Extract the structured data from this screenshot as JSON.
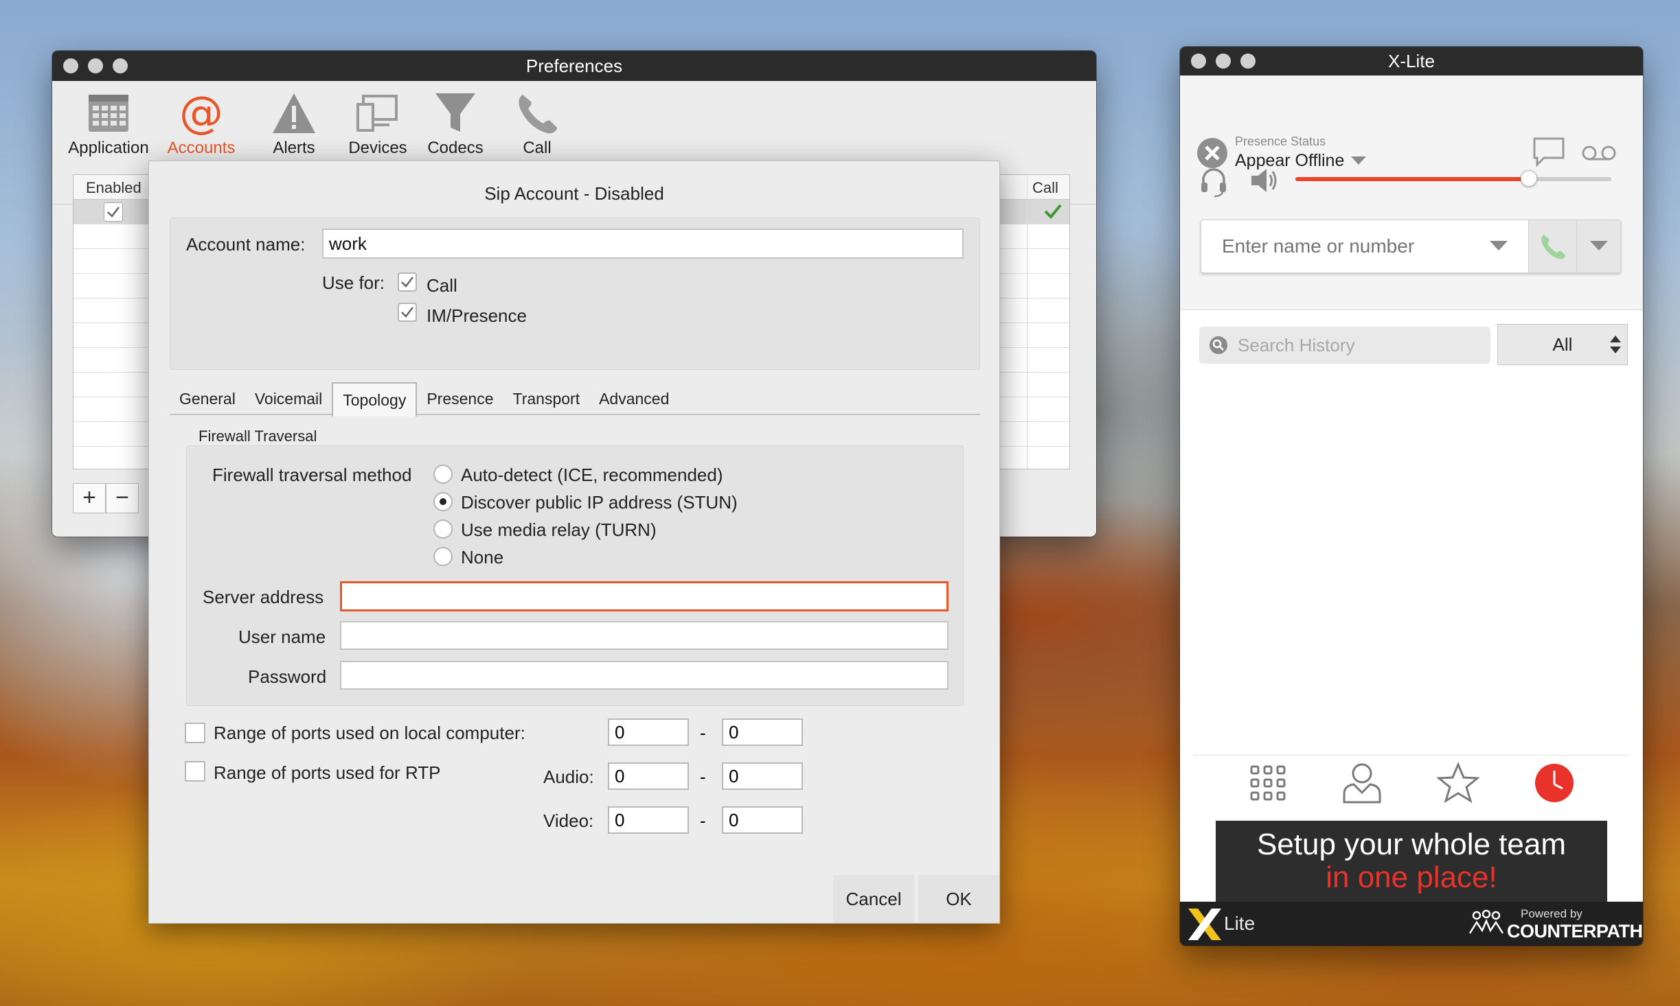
{
  "preferences": {
    "title": "Preferences",
    "toolbar": {
      "items": [
        {
          "label": "Application",
          "icon": "calendar-grid-icon"
        },
        {
          "label": "Accounts",
          "icon": "at-sign-icon"
        },
        {
          "label": "Alerts",
          "icon": "warning-triangle-icon"
        },
        {
          "label": "Devices",
          "icon": "devices-icon"
        },
        {
          "label": "Codecs",
          "icon": "funnel-icon"
        },
        {
          "label": "Call",
          "icon": "phone-icon"
        }
      ],
      "active": "Accounts"
    },
    "table": {
      "col_enabled": "Enabled",
      "col_call": "Call"
    },
    "add_label": "+",
    "remove_label": "−"
  },
  "sheet": {
    "title": "Sip Account - Disabled",
    "account_name_label": "Account name:",
    "account_name_value": "work",
    "use_for_label": "Use for:",
    "use_for": [
      {
        "label": "Call",
        "checked": true
      },
      {
        "label": "IM/Presence",
        "checked": true
      }
    ],
    "tabs": [
      "General",
      "Voicemail",
      "Topology",
      "Presence",
      "Transport",
      "Advanced"
    ],
    "active_tab": "Topology",
    "section_title": "Firewall Traversal",
    "method_label": "Firewall traversal method",
    "methods": [
      {
        "label": "Auto-detect (ICE, recommended)",
        "selected": false
      },
      {
        "label": "Discover public IP address (STUN)",
        "selected": true
      },
      {
        "label": "Use media relay (TURN)",
        "selected": false
      },
      {
        "label": "None",
        "selected": false
      }
    ],
    "server_address_label": "Server address",
    "server_address_value": "",
    "user_name_label": "User name",
    "user_name_value": "",
    "password_label": "Password",
    "password_value": "",
    "local_ports_label": "Range of ports used on local computer:",
    "rtp_ports_label": "Range of ports used for RTP",
    "audio_label": "Audio:",
    "video_label": "Video:",
    "dash": "-",
    "ports": {
      "local": [
        "0",
        "0"
      ],
      "audio": [
        "0",
        "0"
      ],
      "video": [
        "0",
        "0"
      ]
    },
    "cancel_label": "Cancel",
    "ok_label": "OK"
  },
  "xlite": {
    "title": "X-Lite",
    "presence_label": "Presence Status",
    "presence_value": "Appear Offline",
    "volume_level": 0.74,
    "dial_placeholder": "Enter name or number",
    "search_placeholder": "Search History",
    "filter_value": "All",
    "banner_line1": "Setup your whole team",
    "banner_line2": "in one place!",
    "footer_logo": "Lite",
    "powered_by": "Powered by",
    "brand": "COUNTERPATH",
    "accent": "#e8452a"
  }
}
